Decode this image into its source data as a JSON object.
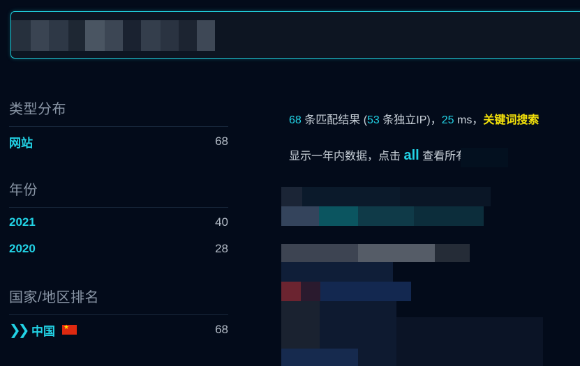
{
  "search": {
    "placeholder": "",
    "value": ""
  },
  "sidebar": {
    "type": {
      "title": "类型分布",
      "items": [
        {
          "label": "网站",
          "count": "68"
        }
      ]
    },
    "year": {
      "title": "年份",
      "items": [
        {
          "label": "2021",
          "count": "40"
        },
        {
          "label": "2020",
          "count": "28"
        }
      ]
    },
    "country": {
      "title": "国家/地区排名",
      "items": [
        {
          "label": "中国",
          "count": "68"
        }
      ]
    }
  },
  "results": {
    "match_count": "68",
    "match_text": "条匹配结果 (",
    "unique_ip_count": "53",
    "unique_ip_text": "条独立IP)，",
    "time_value": "25",
    "time_unit": "ms，",
    "keyword_link": "关键词搜索",
    "hint_prefix": "显示一年内数据，点击",
    "hint_link": "all",
    "hint_suffix": "查看所有"
  },
  "colors": {
    "accent": "#22d3e6",
    "keyword": "#f5e20a",
    "background": "#030b1a"
  },
  "icons": {
    "expand": "double-chevron-right-icon",
    "flag": "china-flag-icon"
  }
}
